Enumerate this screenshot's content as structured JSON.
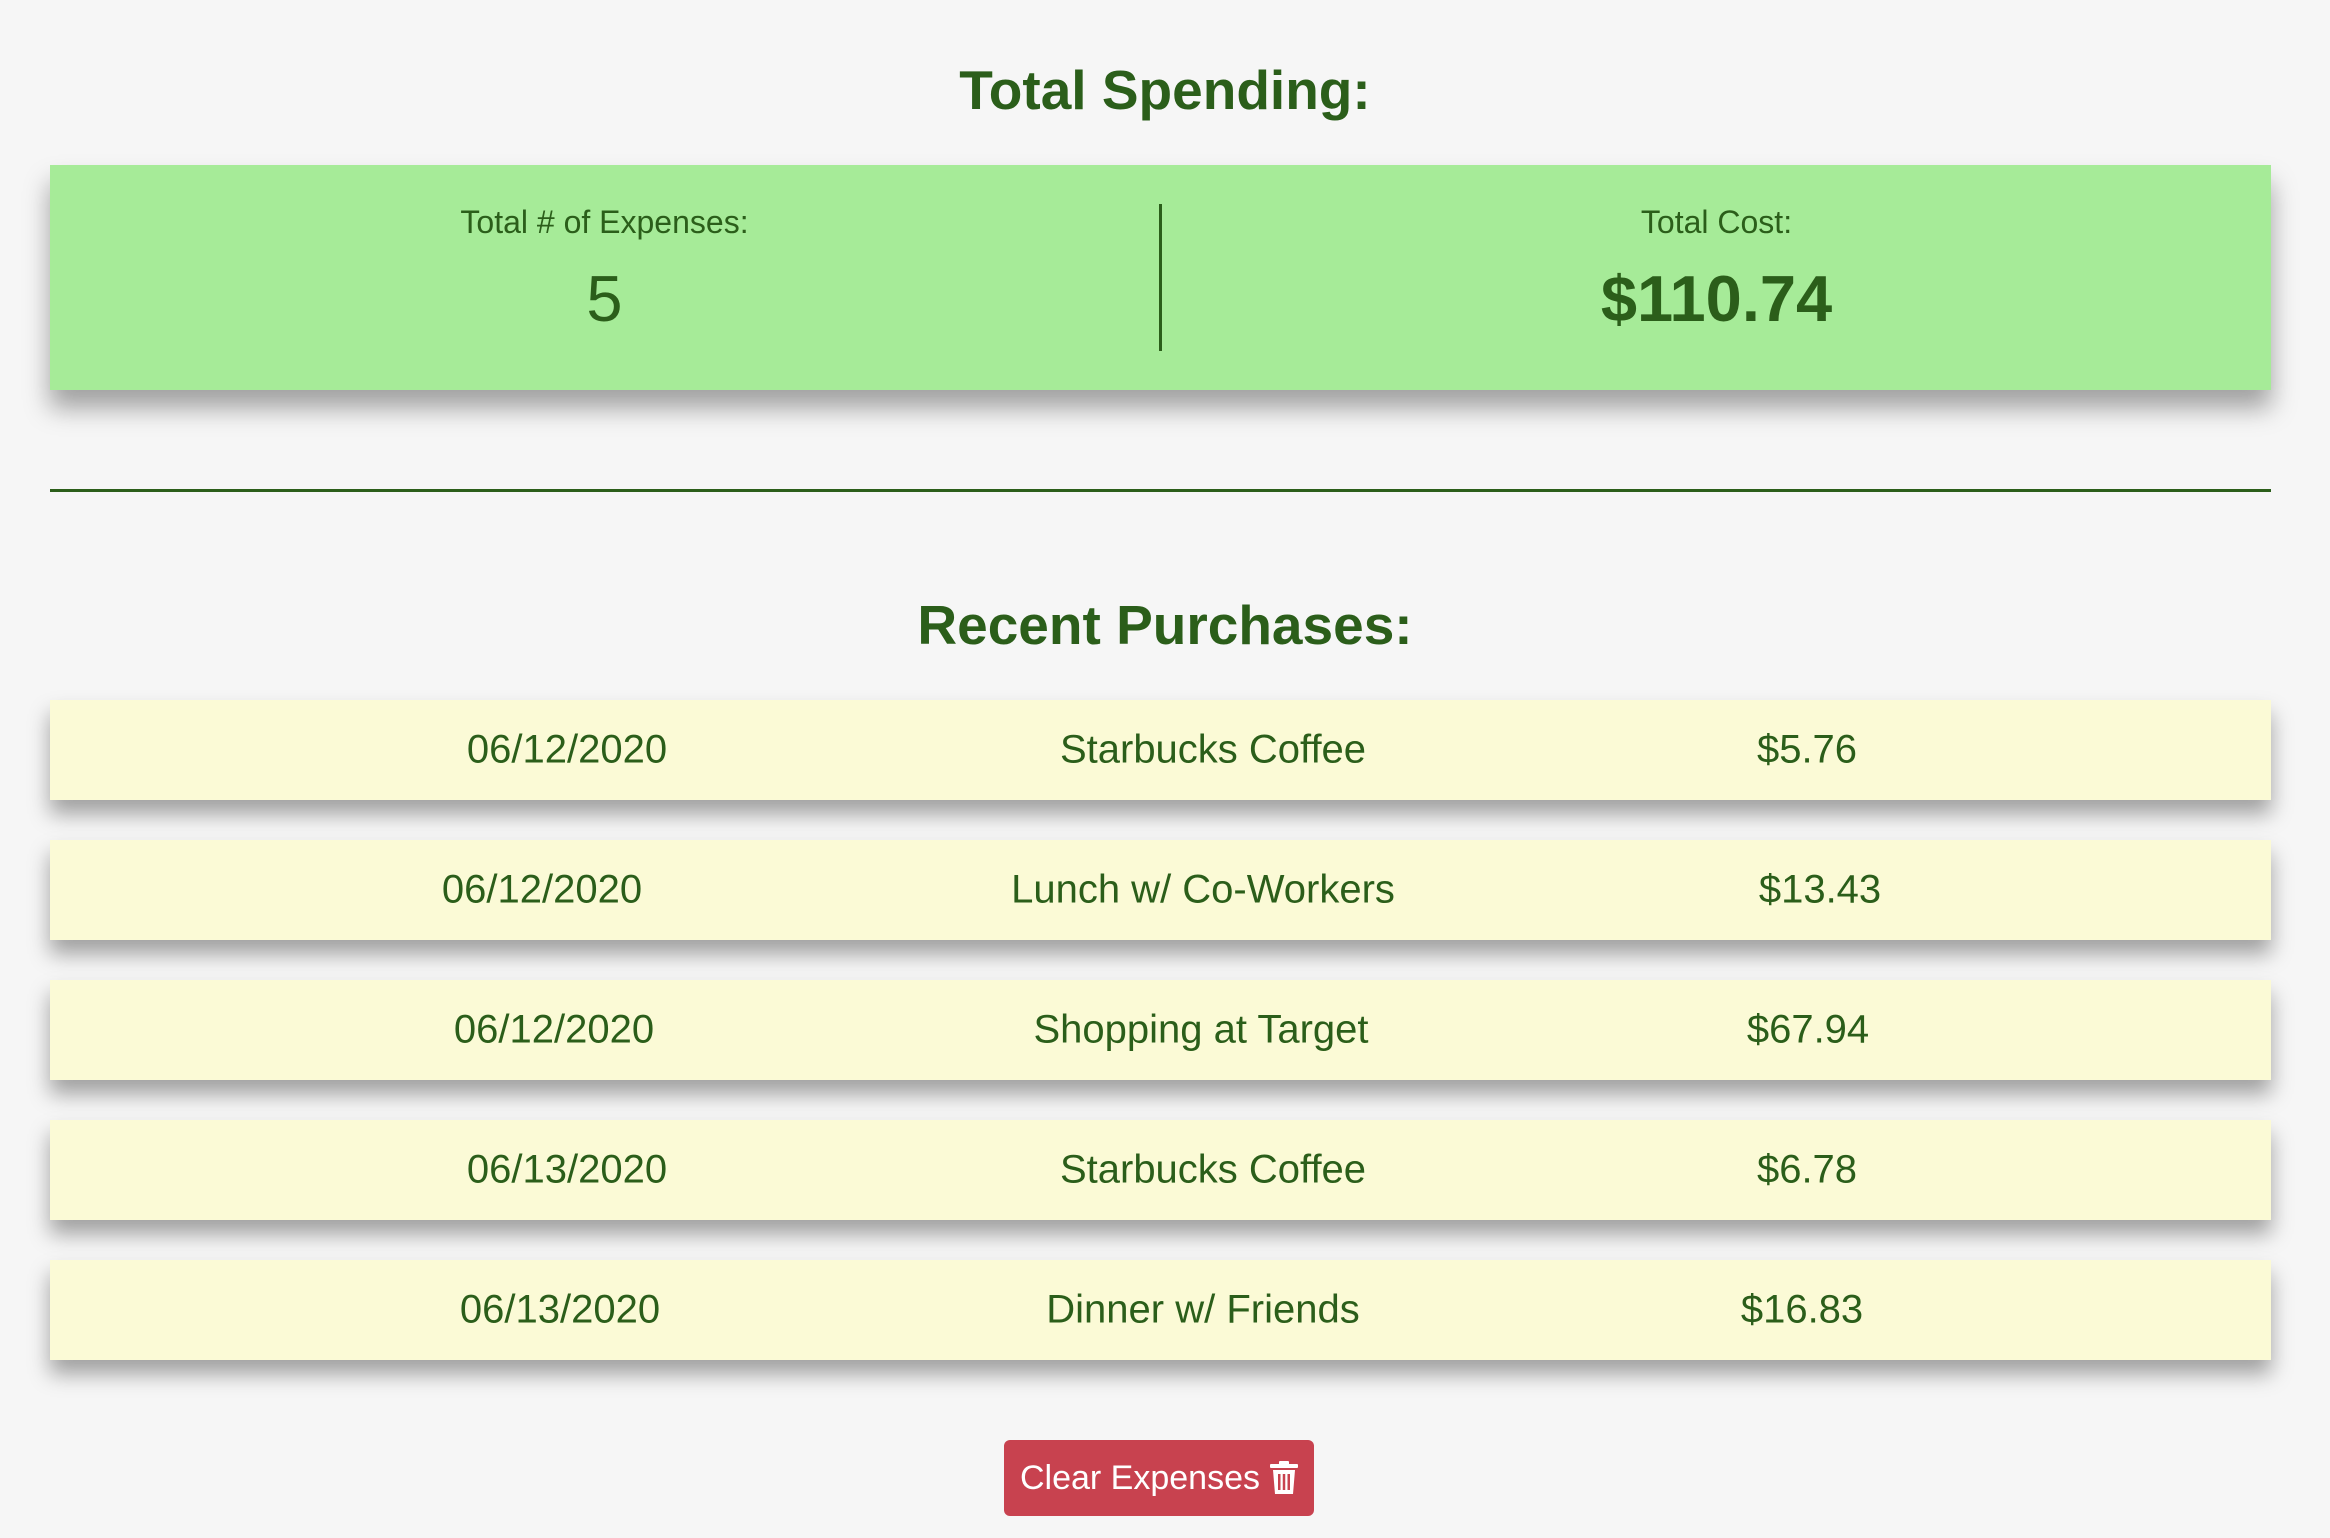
{
  "total_section": {
    "heading": "Total Spending:",
    "count_label": "Total # of Expenses:",
    "count_value": "5",
    "cost_label": "Total Cost:",
    "cost_value": "$110.74"
  },
  "recent_section": {
    "heading": "Recent Purchases:",
    "purchases": [
      {
        "date": "06/12/2020",
        "description": "Starbucks Coffee",
        "amount": "$5.76"
      },
      {
        "date": "06/12/2020",
        "description": "Lunch w/ Co-Workers",
        "amount": "$13.43"
      },
      {
        "date": "06/12/2020",
        "description": "Shopping at Target",
        "amount": "$67.94"
      },
      {
        "date": "06/13/2020",
        "description": "Starbucks Coffee",
        "amount": "$6.78"
      },
      {
        "date": "06/13/2020",
        "description": "Dinner w/ Friends",
        "amount": "$16.83"
      }
    ]
  },
  "clear_button": {
    "label": "Clear Expenses",
    "icon": "trash-icon"
  },
  "colors": {
    "text_green": "#2b5e1a",
    "summary_bg": "#a6eb98",
    "row_bg": "#fbfad6",
    "button_red": "#c8424f",
    "page_bg": "#f6f6f6"
  }
}
